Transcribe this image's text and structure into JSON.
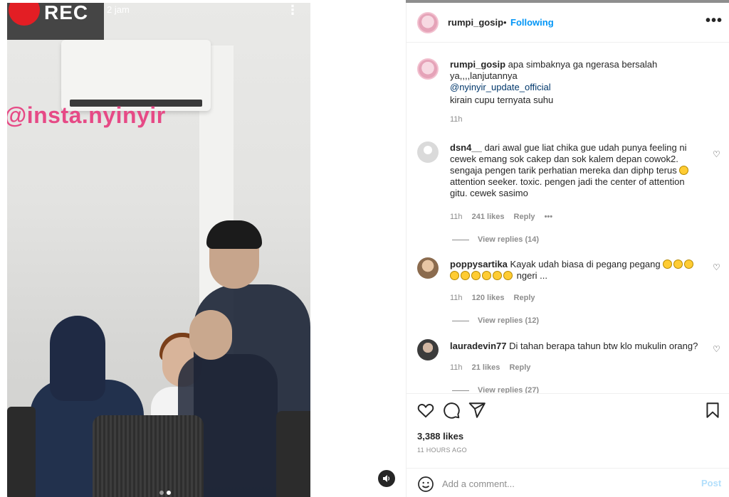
{
  "media": {
    "rec_label": "REC",
    "time_label": "2 jam",
    "watermark": "@insta.nyinyir"
  },
  "header": {
    "username": "rumpi_gosip",
    "separator": "•",
    "follow_label": "Following",
    "more_label": "•••"
  },
  "caption": {
    "username": "rumpi_gosip",
    "text": "apa simbaknya ga ngerasa bersalah ya,,,,lanjutannya",
    "mention": "@nyinyir_update_official",
    "text2": "kirain cupu ternyata suhu",
    "time": "11h"
  },
  "comments": [
    {
      "username": "dsn4__",
      "text_a": "dari awal gue liat chika gue udah punya feeling ni cewek emang sok cakep dan sok kalem depan cowok2. sengaja pengen tarik perhatian mereka dan diphp terus",
      "text_b": "attention seeker. toxic. pengen jadi the center of attention gitu. cewek sasimo",
      "time": "11h",
      "likes": "241 likes",
      "reply": "Reply",
      "more": "•••",
      "view_replies": "View replies (14)"
    },
    {
      "username": "poppysartika",
      "text_a": "Kayak udah biasa di pegang pegang",
      "text_b": "ngeri ...",
      "time": "11h",
      "likes": "120 likes",
      "reply": "Reply",
      "view_replies": "View replies (12)"
    },
    {
      "username": "lauradevin77",
      "text_a": "Di tahan berapa tahun btw klo mukulin orang?",
      "time": "11h",
      "likes": "21 likes",
      "reply": "Reply",
      "view_replies": "View replies (27)"
    }
  ],
  "footer": {
    "likes": "3,388 likes",
    "ago": "11 HOURS AGO",
    "add_comment_placeholder": "Add a comment...",
    "post_label": "Post"
  },
  "colors": {
    "accent": "#0095f6",
    "post_disabled": "#b2dffc",
    "rec_red": "#e31e24",
    "watermark": "#e64a86"
  }
}
